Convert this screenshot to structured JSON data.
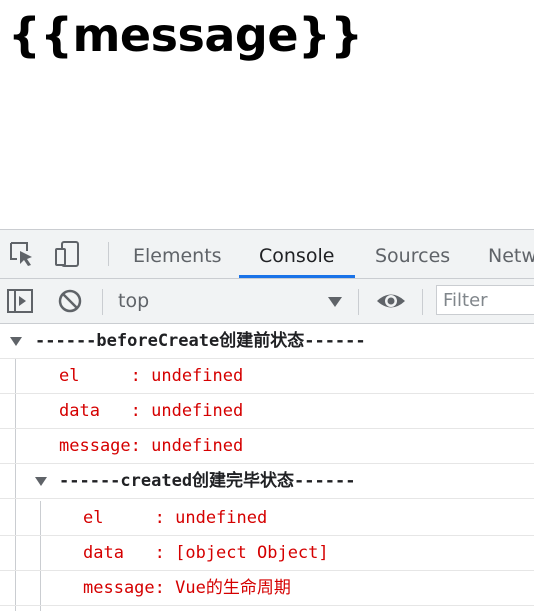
{
  "page": {
    "heading": "{{message}}"
  },
  "devtools": {
    "tabs": [
      {
        "label": "Elements",
        "active": false
      },
      {
        "label": "Console",
        "active": true
      },
      {
        "label": "Sources",
        "active": false
      },
      {
        "label": "Netw",
        "active": false
      }
    ],
    "toolbar": {
      "context": "top",
      "filter_placeholder": "Filter"
    },
    "icons": [
      "inspect-element-icon",
      "device-toggle-icon",
      "sidebar-toggle-icon",
      "clear-console-icon",
      "eye-icon"
    ],
    "accent_color": "#1a73e8",
    "log_color": "#d50000"
  },
  "console": {
    "group1": {
      "title": "------beforeCreate创建前状态------",
      "lines": [
        "el     : undefined",
        "data   : undefined",
        "message: undefined"
      ]
    },
    "group2": {
      "title": "------created创建完毕状态------",
      "lines": [
        "el     : undefined",
        "data   : [object Object]",
        "message: Vue的生命周期"
      ]
    }
  }
}
